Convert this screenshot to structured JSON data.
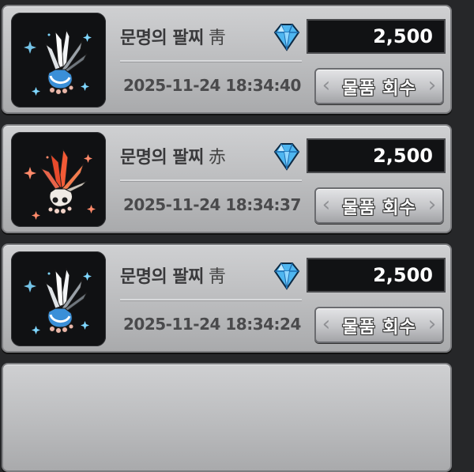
{
  "items": [
    {
      "name": "문명의 팔찌",
      "color_tag": "靑",
      "price": "2,500",
      "date": "2025-11-24 18:34:40",
      "button_label": "물품 회수",
      "variant": "blue"
    },
    {
      "name": "문명의 팔찌",
      "color_tag": "赤",
      "price": "2,500",
      "date": "2025-11-24 18:34:37",
      "button_label": "물품 회수",
      "variant": "red"
    },
    {
      "name": "문명의 팔찌",
      "color_tag": "靑",
      "price": "2,500",
      "date": "2025-11-24 18:34:24",
      "button_label": "물품 회수",
      "variant": "blue"
    }
  ],
  "colors": {
    "card_bg": "#c2c3c5",
    "price_box": "#111214",
    "gem": "#4fb6f0",
    "blue_item": "#3a8fd8",
    "red_item": "#d9583a"
  },
  "icons": {
    "currency": "blue-diamond-gem-icon",
    "item": "feathered-bracelet-icon"
  }
}
